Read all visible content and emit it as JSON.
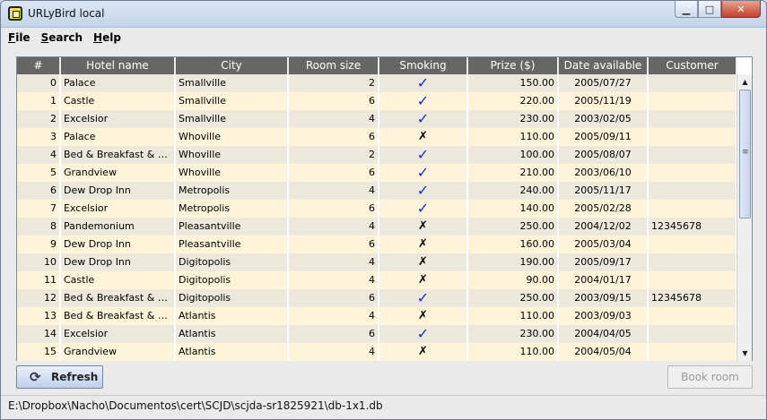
{
  "window": {
    "title": "URLyBird local"
  },
  "menu": [
    {
      "mnemonic": "F",
      "rest": "ile"
    },
    {
      "mnemonic": "S",
      "rest": "earch"
    },
    {
      "mnemonic": "H",
      "rest": "elp"
    }
  ],
  "table": {
    "headers": [
      "#",
      "Hotel name",
      "City",
      "Room size",
      "Smoking",
      "Prize ($)",
      "Date available",
      "Customer"
    ],
    "rows": [
      [
        "0",
        "Palace",
        "Smallville",
        "2",
        "yes",
        "150.00",
        "2005/07/27",
        ""
      ],
      [
        "1",
        "Castle",
        "Smallville",
        "6",
        "yes",
        "220.00",
        "2005/11/19",
        ""
      ],
      [
        "2",
        "Excelsior",
        "Smallville",
        "4",
        "yes",
        "230.00",
        "2003/02/05",
        ""
      ],
      [
        "3",
        "Palace",
        "Whoville",
        "6",
        "no",
        "110.00",
        "2005/09/11",
        ""
      ],
      [
        "4",
        "Bed & Breakfast & Busi...",
        "Whoville",
        "2",
        "yes",
        "100.00",
        "2005/08/07",
        ""
      ],
      [
        "5",
        "Grandview",
        "Whoville",
        "6",
        "yes",
        "210.00",
        "2003/06/10",
        ""
      ],
      [
        "6",
        "Dew Drop Inn",
        "Metropolis",
        "4",
        "yes",
        "240.00",
        "2005/11/17",
        ""
      ],
      [
        "7",
        "Excelsior",
        "Metropolis",
        "6",
        "yes",
        "140.00",
        "2005/02/28",
        ""
      ],
      [
        "8",
        "Pandemonium",
        "Pleasantville",
        "4",
        "no",
        "250.00",
        "2004/12/02",
        "12345678"
      ],
      [
        "9",
        "Dew Drop Inn",
        "Pleasantville",
        "6",
        "no",
        "160.00",
        "2005/03/04",
        ""
      ],
      [
        "10",
        "Dew Drop Inn",
        "Digitopolis",
        "4",
        "no",
        "190.00",
        "2005/09/17",
        ""
      ],
      [
        "11",
        "Castle",
        "Digitopolis",
        "4",
        "no",
        "90.00",
        "2004/01/17",
        ""
      ],
      [
        "12",
        "Bed & Breakfast & Busi...",
        "Digitopolis",
        "6",
        "yes",
        "250.00",
        "2003/09/15",
        "12345678"
      ],
      [
        "13",
        "Bed & Breakfast & Busi...",
        "Atlantis",
        "4",
        "no",
        "110.00",
        "2003/09/03",
        ""
      ],
      [
        "14",
        "Excelsior",
        "Atlantis",
        "6",
        "yes",
        "230.00",
        "2004/04/05",
        ""
      ],
      [
        "15",
        "Grandview",
        "Atlantis",
        "4",
        "no",
        "110.00",
        "2004/05/04",
        ""
      ]
    ],
    "smoking_icons": {
      "yes": "checkmark-icon",
      "no": "cross-icon"
    }
  },
  "buttons": {
    "refresh": "Refresh",
    "book": "Book room"
  },
  "status": {
    "path": "E:\\Dropbox\\Nacho\\Documentos\\cert\\SCJD\\scjda-sr1825921\\db-1x1.db"
  },
  "colors": {
    "header_bg": "#666666",
    "row_odd": "#fff4d9",
    "row_even": "#ece8dc",
    "check": "#1a2cc8"
  }
}
